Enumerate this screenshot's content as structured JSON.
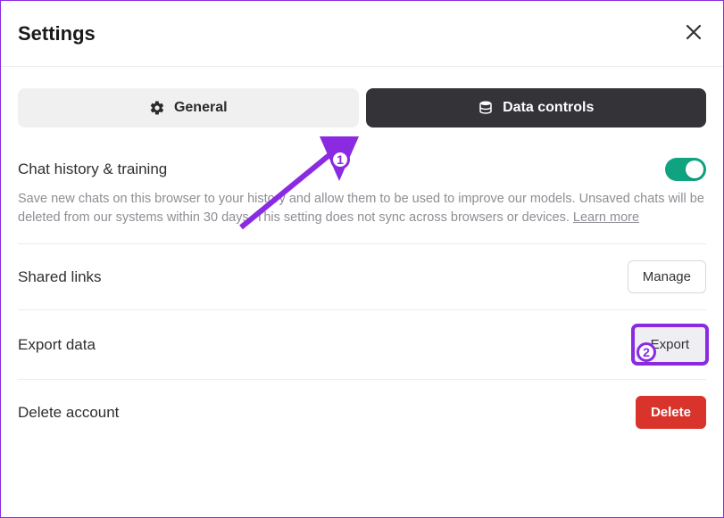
{
  "header": {
    "title": "Settings"
  },
  "tabs": {
    "general": "General",
    "data_controls": "Data controls"
  },
  "sections": {
    "history": {
      "title": "Chat history & training",
      "description": "Save new chats on this browser to your history and allow them to be used to improve our models. Unsaved chats will be deleted from our systems within 30 days. This setting does not sync across browsers or devices. ",
      "learn_more": "Learn more",
      "toggle_on": true
    },
    "shared_links": {
      "title": "Shared links",
      "button": "Manage"
    },
    "export_data": {
      "title": "Export data",
      "button": "Export"
    },
    "delete_account": {
      "title": "Delete account",
      "button": "Delete"
    }
  },
  "annotations": {
    "one": "1",
    "two": "2"
  }
}
